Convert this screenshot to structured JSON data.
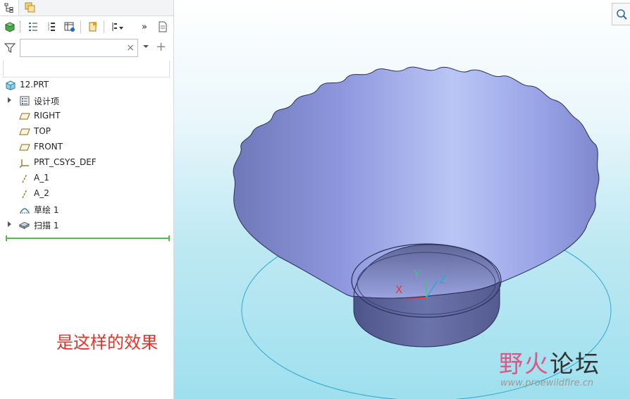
{
  "model_tree": {
    "root_label": "12.PRT",
    "items": [
      {
        "label": "设计项",
        "icon": "design-items-icon",
        "expandable": true
      },
      {
        "label": "RIGHT",
        "icon": "datum-plane-icon",
        "expandable": false
      },
      {
        "label": "TOP",
        "icon": "datum-plane-icon",
        "expandable": false
      },
      {
        "label": "FRONT",
        "icon": "datum-plane-icon",
        "expandable": false
      },
      {
        "label": "PRT_CSYS_DEF",
        "icon": "coordinate-system-icon",
        "expandable": false
      },
      {
        "label": "A_1",
        "icon": "datum-axis-icon",
        "expandable": false
      },
      {
        "label": "A_2",
        "icon": "datum-axis-icon",
        "expandable": false
      },
      {
        "label": "草绘 1",
        "icon": "sketch-icon",
        "expandable": false
      },
      {
        "label": "扫描 1",
        "icon": "sweep-icon",
        "expandable": true
      }
    ]
  },
  "search": {
    "placeholder": "",
    "value": "",
    "clear": "×"
  },
  "toolbar": {
    "more": "»"
  },
  "filter_add": "+",
  "annotation": "是这样的效果",
  "viewport": {
    "axes": {
      "x": "X",
      "y": "Y",
      "z": "Z"
    },
    "model_color": "#8f98de",
    "background_bottom": "#9ee0ee"
  },
  "watermark": {
    "title_part1": "野火",
    "title_part2": "论坛",
    "url": "www.proewildfire.cn"
  }
}
